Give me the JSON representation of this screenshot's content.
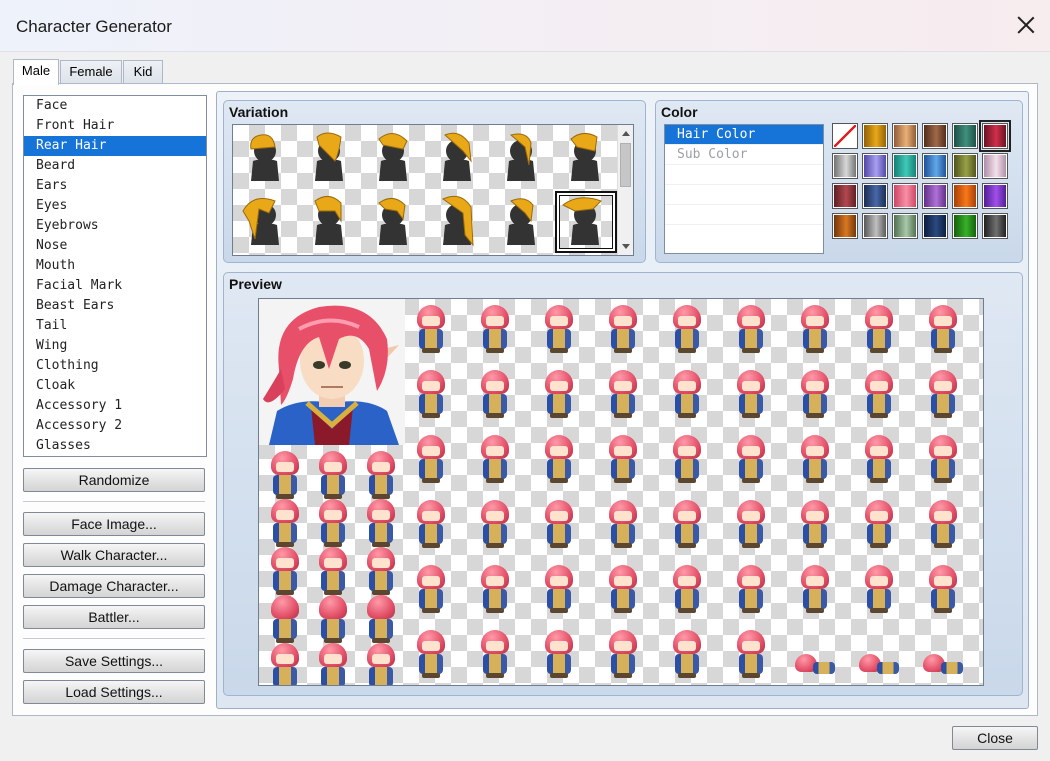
{
  "window": {
    "title": "Character Generator"
  },
  "tabs": [
    {
      "label": "Male",
      "active": true
    },
    {
      "label": "Female",
      "active": false
    },
    {
      "label": "Kid",
      "active": false
    }
  ],
  "parts": {
    "selected_index": 2,
    "items": [
      "Face",
      "Front Hair",
      "Rear Hair",
      "Beard",
      "Ears",
      "Eyes",
      "Eyebrows",
      "Nose",
      "Mouth",
      "Facial Mark",
      "Beast Ears",
      "Tail",
      "Wing",
      "Clothing",
      "Cloak",
      "Accessory 1",
      "Accessory 2",
      "Glasses"
    ]
  },
  "buttons": {
    "randomize": "Randomize",
    "face_image": "Face Image...",
    "walk_character": "Walk Character...",
    "damage_character": "Damage Character...",
    "battler": "Battler...",
    "save_settings": "Save Settings...",
    "load_settings": "Load Settings...",
    "close": "Close"
  },
  "variation": {
    "title": "Variation",
    "selected_index": 11,
    "hair_color": "#e8a818",
    "silhouette_color": "#333333"
  },
  "color": {
    "title": "Color",
    "items": [
      {
        "label": "Hair Color",
        "state": "selected"
      },
      {
        "label": "Sub Color",
        "state": "dim"
      }
    ],
    "selected_swatch": 5,
    "swatches": [
      {
        "name": "none",
        "colors": [
          "#ffffff",
          "#ffffff"
        ]
      },
      {
        "name": "gold",
        "colors": [
          "#e8a818",
          "#8a5a08"
        ]
      },
      {
        "name": "tan",
        "colors": [
          "#e8b078",
          "#8a5430"
        ]
      },
      {
        "name": "brown",
        "colors": [
          "#a06848",
          "#4a2a18"
        ]
      },
      {
        "name": "teal",
        "colors": [
          "#40907e",
          "#1a4a40"
        ]
      },
      {
        "name": "crimson",
        "colors": [
          "#d0304a",
          "#60101e"
        ]
      },
      {
        "name": "silver",
        "colors": [
          "#d8d8d8",
          "#6a6a6a"
        ]
      },
      {
        "name": "lavender",
        "colors": [
          "#a8a0f0",
          "#4a40a0"
        ]
      },
      {
        "name": "aqua",
        "colors": [
          "#40c8b8",
          "#107a70"
        ]
      },
      {
        "name": "sky",
        "colors": [
          "#60a8e8",
          "#1a4a90"
        ]
      },
      {
        "name": "olive",
        "colors": [
          "#98a048",
          "#4a5018"
        ]
      },
      {
        "name": "pale-pink",
        "colors": [
          "#f4e0ec",
          "#a888a0"
        ]
      },
      {
        "name": "wine",
        "colors": [
          "#b04850",
          "#5a1a20"
        ]
      },
      {
        "name": "navy",
        "colors": [
          "#4868a8",
          "#18284a"
        ]
      },
      {
        "name": "pink",
        "colors": [
          "#f890a8",
          "#c84060"
        ]
      },
      {
        "name": "purple",
        "colors": [
          "#b070d8",
          "#5a2a80"
        ]
      },
      {
        "name": "orange",
        "colors": [
          "#f87818",
          "#a03a08"
        ]
      },
      {
        "name": "violet",
        "colors": [
          "#a050e8",
          "#4a1a90"
        ]
      },
      {
        "name": "copper",
        "colors": [
          "#d87820",
          "#6a3008"
        ]
      },
      {
        "name": "gray",
        "colors": [
          "#c0c0c0",
          "#505050"
        ]
      },
      {
        "name": "sage",
        "colors": [
          "#a8c8a8",
          "#4a684a"
        ]
      },
      {
        "name": "midnight",
        "colors": [
          "#2a4a80",
          "#0a1a3a"
        ]
      },
      {
        "name": "green",
        "colors": [
          "#38b028",
          "#105a08"
        ]
      },
      {
        "name": "charcoal",
        "colors": [
          "#707070",
          "#1a1a1a"
        ]
      }
    ]
  },
  "preview": {
    "title": "Preview",
    "hair_color": "#e35068"
  }
}
